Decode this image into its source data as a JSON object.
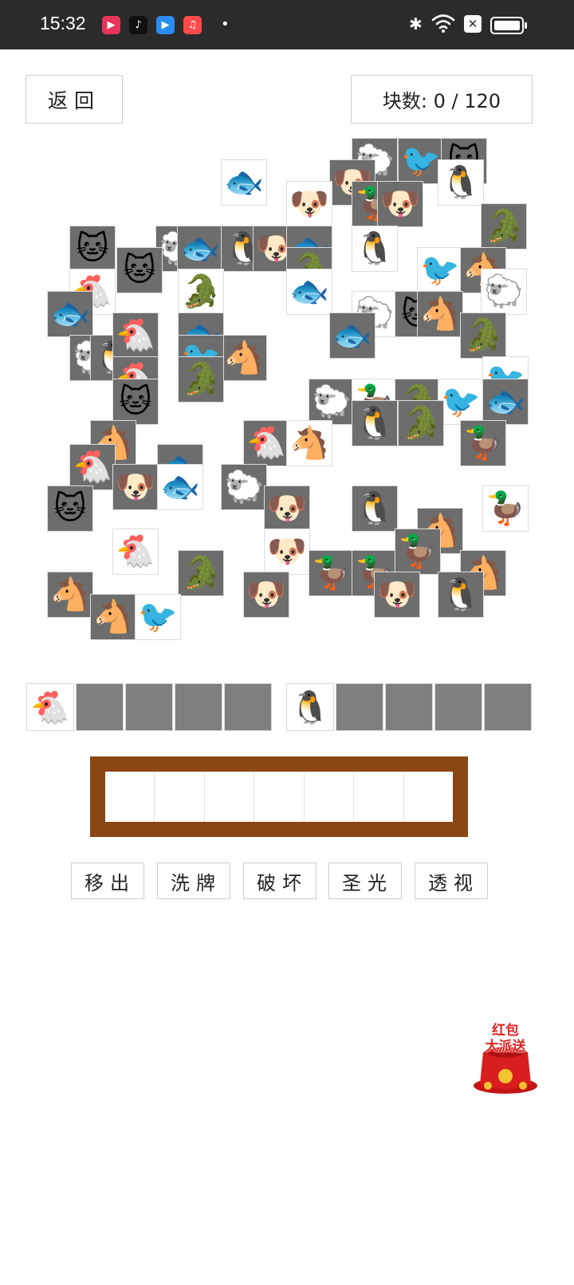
{
  "status_bar": {
    "time": "15:32",
    "apps": [
      {
        "name": "video-app-icon",
        "color": "#e8345a",
        "glyph": "▶"
      },
      {
        "name": "tiktok-app-icon",
        "color": "#111111",
        "glyph": "♪"
      },
      {
        "name": "player-app-icon",
        "color": "#2a8cf0",
        "glyph": "▶"
      },
      {
        "name": "music-app-icon",
        "color": "#ff4b4b",
        "glyph": "♫"
      }
    ],
    "bluetooth_icon": "✱",
    "wifi_icon": "wifi",
    "sim_icon": "✕"
  },
  "header": {
    "back_label": "返回",
    "counter_label": "块数: 0 / 120"
  },
  "animals": {
    "cat": "🐱",
    "dog": "🐶",
    "fish": "🐟",
    "penguin": "🐧",
    "bird": "🐦",
    "duck": "🦆",
    "sheep": "🐑",
    "crocodile": "🐊",
    "chicken": "🐔",
    "horse": "🐴"
  },
  "board": {
    "tiles": [
      {
        "a": "sheep",
        "dim": true
      },
      {
        "a": "bird",
        "dim": true
      },
      {
        "a": "cat",
        "dim": true
      },
      {
        "a": "fish",
        "dim": false
      },
      {
        "a": "dog",
        "dim": true
      },
      {
        "a": "penguin",
        "dim": false
      },
      {
        "a": "dog",
        "dim": false
      },
      {
        "a": "duck",
        "dim": true
      },
      {
        "a": "dog",
        "dim": true
      },
      {
        "a": "crocodile",
        "dim": true
      },
      {
        "a": "cat",
        "dim": true
      },
      {
        "a": "sheep",
        "dim": true
      },
      {
        "a": "fish",
        "dim": true
      },
      {
        "a": "penguin",
        "dim": true
      },
      {
        "a": "dog",
        "dim": true
      },
      {
        "a": "fish",
        "dim": true
      },
      {
        "a": "crocodile",
        "dim": true
      },
      {
        "a": "penguin",
        "dim": false
      },
      {
        "a": "cat",
        "dim": true
      },
      {
        "a": "bird",
        "dim": false
      },
      {
        "a": "horse",
        "dim": true
      },
      {
        "a": "sheep",
        "dim": false
      },
      {
        "a": "chicken",
        "dim": false
      },
      {
        "a": "fish",
        "dim": true
      },
      {
        "a": "crocodile",
        "dim": false
      },
      {
        "a": "fish",
        "dim": false
      },
      {
        "a": "sheep",
        "dim": false
      },
      {
        "a": "cat",
        "dim": true
      },
      {
        "a": "horse",
        "dim": true
      },
      {
        "a": "crocodile",
        "dim": true
      },
      {
        "a": "sheep",
        "dim": true
      },
      {
        "a": "penguin",
        "dim": true
      },
      {
        "a": "fish",
        "dim": true
      },
      {
        "a": "chicken",
        "dim": true
      },
      {
        "a": "fish",
        "dim": true
      },
      {
        "a": "horse",
        "dim": true
      },
      {
        "a": "bird",
        "dim": true
      },
      {
        "a": "chicken",
        "dim": true
      },
      {
        "a": "crocodile",
        "dim": true
      },
      {
        "a": "bird",
        "dim": false
      },
      {
        "a": "cat",
        "dim": true
      },
      {
        "a": "sheep",
        "dim": true
      },
      {
        "a": "duck",
        "dim": false
      },
      {
        "a": "crocodile",
        "dim": true
      },
      {
        "a": "bird",
        "dim": false
      },
      {
        "a": "fish",
        "dim": true
      },
      {
        "a": "horse",
        "dim": true
      },
      {
        "a": "chicken",
        "dim": true
      },
      {
        "a": "horse",
        "dim": false
      },
      {
        "a": "penguin",
        "dim": true
      },
      {
        "a": "crocodile",
        "dim": true
      },
      {
        "a": "duck",
        "dim": true
      },
      {
        "a": "chicken",
        "dim": true
      },
      {
        "a": "fish",
        "dim": true
      },
      {
        "a": "dog",
        "dim": true
      },
      {
        "a": "fish",
        "dim": false
      },
      {
        "a": "cat",
        "dim": true
      },
      {
        "a": "sheep",
        "dim": true
      },
      {
        "a": "dog",
        "dim": true
      },
      {
        "a": "penguin",
        "dim": true
      },
      {
        "a": "duck",
        "dim": false
      },
      {
        "a": "horse",
        "dim": true
      },
      {
        "a": "chicken",
        "dim": false
      },
      {
        "a": "dog",
        "dim": false
      },
      {
        "a": "duck",
        "dim": true
      },
      {
        "a": "duck",
        "dim": true
      },
      {
        "a": "horse",
        "dim": true
      },
      {
        "a": "crocodile",
        "dim": true
      },
      {
        "a": "horse",
        "dim": true
      },
      {
        "a": "horse",
        "dim": true
      },
      {
        "a": "bird",
        "dim": false
      },
      {
        "a": "dog",
        "dim": true
      },
      {
        "a": "duck",
        "dim": true
      },
      {
        "a": "dog",
        "dim": true
      },
      {
        "a": "penguin",
        "dim": true
      }
    ]
  },
  "slots": {
    "left": [
      {
        "a": "chicken"
      },
      {
        "a": ""
      },
      {
        "a": ""
      },
      {
        "a": ""
      },
      {
        "a": ""
      }
    ],
    "right": [
      {
        "a": "penguin"
      },
      {
        "a": ""
      },
      {
        "a": ""
      },
      {
        "a": ""
      },
      {
        "a": ""
      }
    ]
  },
  "tray": {
    "cells": 7
  },
  "tools": [
    {
      "label": "移出",
      "name": "remove-button"
    },
    {
      "label": "洗牌",
      "name": "shuffle-button"
    },
    {
      "label": "破坏",
      "name": "destroy-button"
    },
    {
      "label": "圣光",
      "name": "holy-light-button"
    },
    {
      "label": "透视",
      "name": "xray-button"
    }
  ],
  "promo": {
    "line1": "红包",
    "line2": "大派送"
  }
}
